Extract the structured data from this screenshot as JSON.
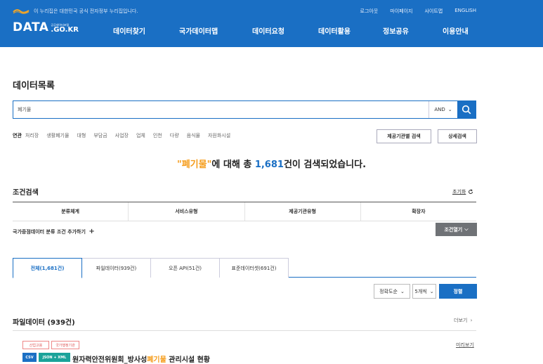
{
  "header": {
    "gov_notice": "이 누리집은 대한민국 공식 전자정부 누리집입니다.",
    "util_links": [
      "로그아웃",
      "마이페이지",
      "사이트맵",
      "ENGLISH"
    ],
    "logo_main": "DATA",
    "logo_sub_small": "공공데이터포털",
    "logo_sub": ".GO.KR",
    "nav": [
      "데이터찾기",
      "국가데이터맵",
      "데이터요청",
      "데이터활용",
      "정보공유",
      "이용안내"
    ],
    "colors": {
      "primary": "#1a6fc4",
      "highlight": "#f59c1a"
    }
  },
  "page": {
    "title": "데이터목록"
  },
  "search": {
    "value": "폐기물",
    "operator": "AND",
    "icon": "search-icon"
  },
  "related": {
    "label": "연관",
    "keywords": [
      "처리장",
      "생활폐기물",
      "대형",
      "부담금",
      "사업장",
      "업체",
      "인천",
      "다량",
      "음식물",
      "자원화시설"
    ]
  },
  "buttons": {
    "provider_search": "제공기관별 검색",
    "detail_search": "상세검색"
  },
  "result": {
    "query": "\"폐기물\"",
    "middle": "에 대해 총 ",
    "count": "1,681",
    "suffix": "건이 검색되었습니다."
  },
  "conditions": {
    "title": "조건검색",
    "reset": "초기화",
    "columns": [
      "분류체계",
      "서비스유형",
      "제공기관유형",
      "확장자"
    ],
    "add_label": "국가중점데이터 분류 조건 추가하기",
    "open_button": "조건열기"
  },
  "tabs": [
    {
      "label": "전체(1,681건)",
      "active": true
    },
    {
      "label": "파일데이터(939건)",
      "active": false
    },
    {
      "label": "오픈 API(51건)",
      "active": false
    },
    {
      "label": "표준데이터셋(691건)",
      "active": false
    }
  ],
  "sort": {
    "order": "정확도순",
    "per_page": "5개씩",
    "button": "정렬"
  },
  "file_section": {
    "title": "파일데이터 (939건)",
    "more": "더보기",
    "item": {
      "tags": [
        "산업고용",
        "국가행정기관"
      ],
      "preview": "미리보기",
      "formats": [
        "CSV",
        "JSON + XML"
      ],
      "title_before": "원자력안전위원회_방사성",
      "title_highlight": "폐기물",
      "title_after": " 관리시설 현황"
    }
  }
}
